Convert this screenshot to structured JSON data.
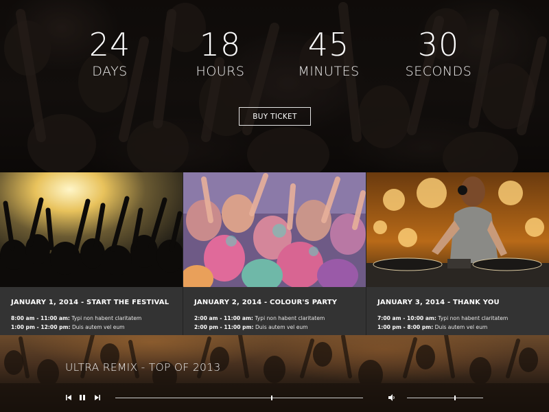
{
  "countdown": {
    "days": {
      "value": "24",
      "label": "DAYS"
    },
    "hours": {
      "value": "18",
      "label": "HOURS"
    },
    "minutes": {
      "value": "45",
      "label": "MINUTES"
    },
    "seconds": {
      "value": "30",
      "label": "SECONDS"
    }
  },
  "hero": {
    "buy_label": "BUY TICKET"
  },
  "events": [
    {
      "title": "JANUARY 1, 2014 - START THE FESTIVAL",
      "lines": [
        {
          "time": "8:00 am - 11:00 am:",
          "text": " Typi non habent claritatem"
        },
        {
          "time": "1:00 pm - 12:00 pm:",
          "text": " Duis autem vel eum"
        }
      ]
    },
    {
      "title": "JANUARY 2, 2014 - COLOUR'S PARTY",
      "lines": [
        {
          "time": "2:00 am - 11:00 am:",
          "text": " Typi non habent claritatem"
        },
        {
          "time": "2:00 pm - 11:00 pm:",
          "text": " Duis autem vel eum"
        }
      ]
    },
    {
      "title": "JANUARY 3, 2014 - THANK YOU",
      "lines": [
        {
          "time": "7:00 am - 10:00 am:",
          "text": " Typi non habent claritatem"
        },
        {
          "time": "1:00 pm - 8:00 pm:",
          "text": " Duis autem vel eum"
        }
      ]
    }
  ],
  "player": {
    "track_title": "ULTRA REMIX - TOP OF 2013",
    "progress": 0.63,
    "volume": 0.62,
    "icons": [
      "previous-icon",
      "pause-icon",
      "next-icon",
      "volume-icon"
    ]
  },
  "colors": {
    "card_bg": "#333333",
    "text": "#ffffff",
    "accent_warm": "#c88a3a"
  }
}
